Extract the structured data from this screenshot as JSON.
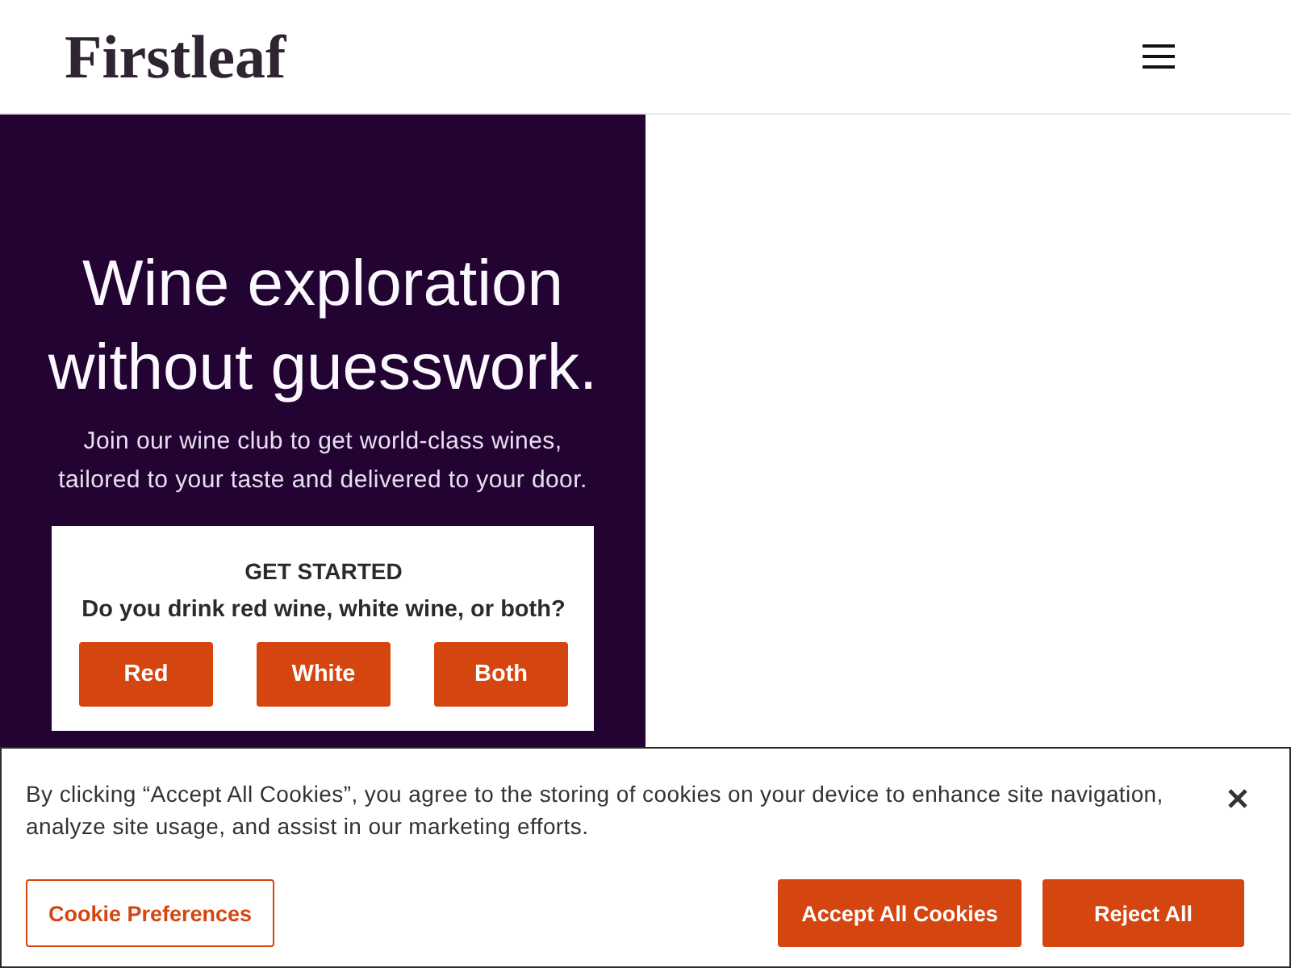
{
  "header": {
    "logo": "Firstleaf"
  },
  "hero": {
    "heading": "Wine exploration without guesswork.",
    "subheading": "Join our wine club to get world-class wines, tailored to your taste and delivered to your door.",
    "card": {
      "title": "GET STARTED",
      "question": "Do you drink red wine, white wine, or both?",
      "options": [
        "Red",
        "White",
        "Both"
      ]
    }
  },
  "cookie_banner": {
    "message": "By clicking “Accept All Cookies”, you agree to the storing of cookies on your device to enhance site navigation, analyze site usage, and assist in our marketing efforts.",
    "buttons": [
      {
        "label": "Cookie Preferences",
        "kind": "outline"
      },
      {
        "label": "Accept All Cookies",
        "kind": "filled"
      },
      {
        "label": "Reject All",
        "kind": "filled"
      }
    ]
  }
}
